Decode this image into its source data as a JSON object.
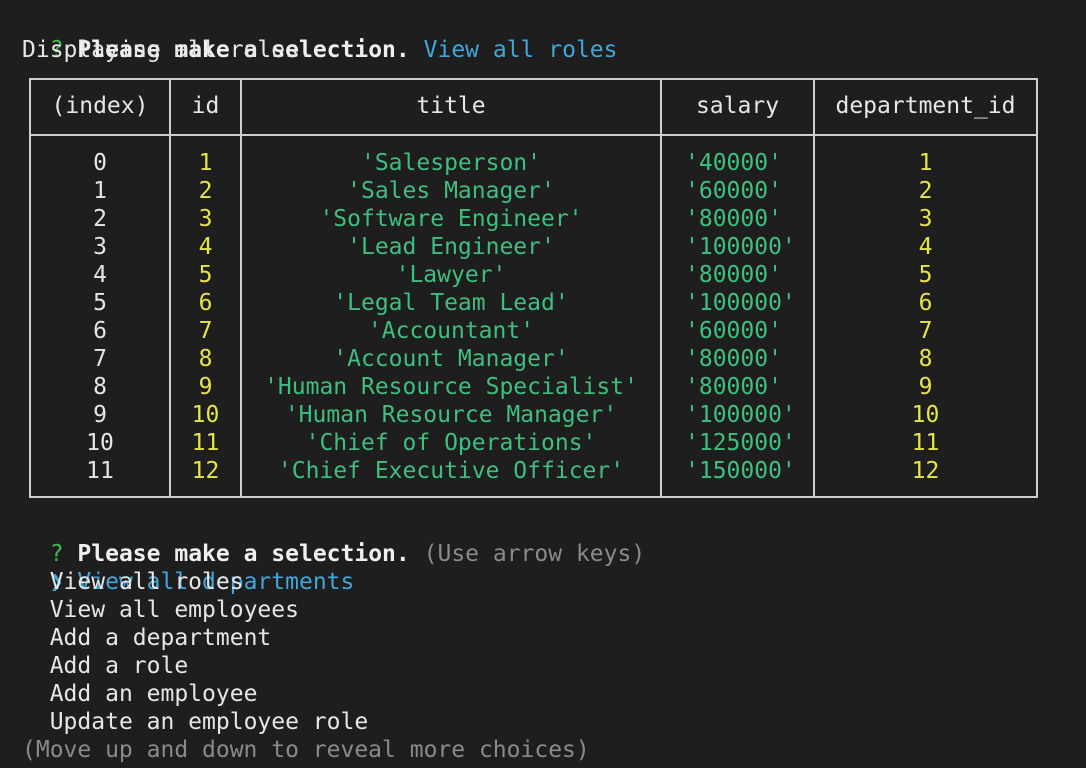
{
  "prompt1": {
    "mark": "?",
    "message": "Please make a selection.",
    "answer": "View all roles"
  },
  "status": "Displaying all roles.",
  "table": {
    "headers": [
      "(index)",
      "id",
      "title",
      "salary",
      "department_id"
    ],
    "rows": [
      {
        "index": "0",
        "id": "1",
        "title": "'Salesperson'",
        "salary": "'40000'",
        "department_id": "1"
      },
      {
        "index": "1",
        "id": "2",
        "title": "'Sales Manager'",
        "salary": "'60000'",
        "department_id": "2"
      },
      {
        "index": "2",
        "id": "3",
        "title": "'Software Engineer'",
        "salary": "'80000'",
        "department_id": "3"
      },
      {
        "index": "3",
        "id": "4",
        "title": "'Lead Engineer'",
        "salary": "'100000'",
        "department_id": "4"
      },
      {
        "index": "4",
        "id": "5",
        "title": "'Lawyer'",
        "salary": "'80000'",
        "department_id": "5"
      },
      {
        "index": "5",
        "id": "6",
        "title": "'Legal Team Lead'",
        "salary": "'100000'",
        "department_id": "6"
      },
      {
        "index": "6",
        "id": "7",
        "title": "'Accountant'",
        "salary": "'60000'",
        "department_id": "7"
      },
      {
        "index": "7",
        "id": "8",
        "title": "'Account Manager'",
        "salary": "'80000'",
        "department_id": "8"
      },
      {
        "index": "8",
        "id": "9",
        "title": "'Human Resource Specialist'",
        "salary": "'80000'",
        "department_id": "9"
      },
      {
        "index": "9",
        "id": "10",
        "title": "'Human Resource Manager'",
        "salary": "'100000'",
        "department_id": "10"
      },
      {
        "index": "10",
        "id": "11",
        "title": "'Chief of Operations'",
        "salary": "'125000'",
        "department_id": "11"
      },
      {
        "index": "11",
        "id": "12",
        "title": "'Chief Executive Officer'",
        "salary": "'150000'",
        "department_id": "12"
      }
    ]
  },
  "prompt2": {
    "mark": "?",
    "message": "Please make a selection.",
    "hint": "(Use arrow keys)",
    "pointer": "❯",
    "choices": [
      "View all departments",
      "View all roles",
      "View all employees",
      "Add a department",
      "Add a role",
      "Add an employee",
      "Update an employee role"
    ],
    "footer": "(Move up and down to reveal more choices)"
  },
  "colors": {
    "background": "#1e1e1e",
    "question_mark": "#3fb950",
    "answer": "#41a6d9",
    "number": "#e5e54a",
    "string": "#3fbf7f",
    "dim": "#8a8a8a"
  }
}
